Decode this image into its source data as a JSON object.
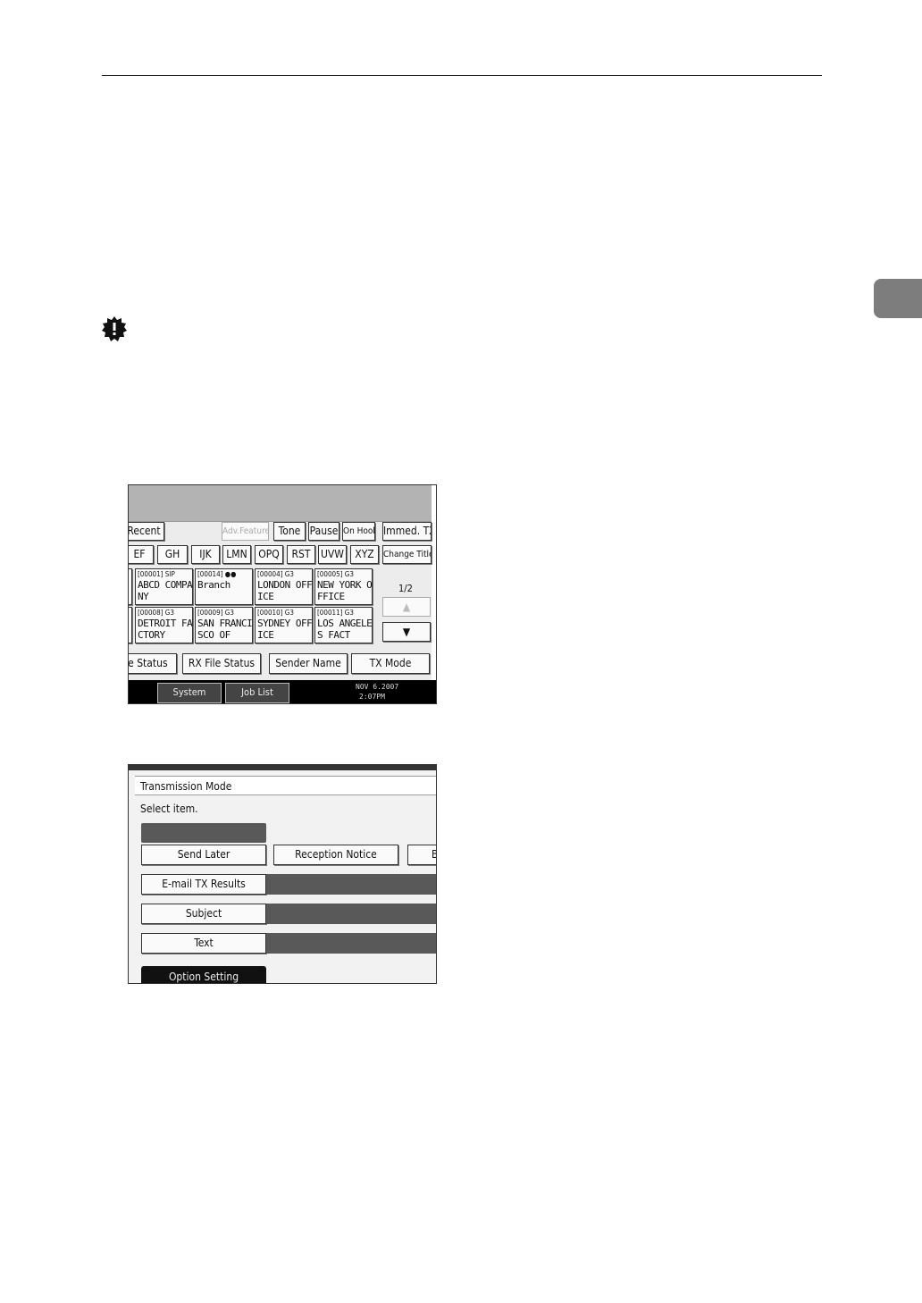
{
  "screen1": {
    "row1": [
      "Recent",
      "Adv.Features",
      "Tone",
      "Pause",
      "On Hook",
      "Immed. TX"
    ],
    "row2": [
      "EF",
      "GH",
      "IJK",
      "LMN",
      "OPQ",
      "RST",
      "UVW",
      "XYZ",
      "Change Title"
    ],
    "entries": [
      {
        "code": "[00001] SIP",
        "name1": "ABCD COMPA",
        "name2": "NY"
      },
      {
        "code": "[00014] ",
        "name1": "Branch",
        "name2": ""
      },
      {
        "code": "[00004] G3",
        "name1": "LONDON OFF",
        "name2": "ICE"
      },
      {
        "code": "[00005] G3",
        "name1": "NEW YORK O",
        "name2": "FFICE"
      },
      {
        "code": "[00008] G3",
        "name1": "DETROIT FA",
        "name2": "CTORY"
      },
      {
        "code": "[00009] G3",
        "name1": "SAN FRANCI",
        "name2": "SCO OF"
      },
      {
        "code": "[00010] G3",
        "name1": "SYDNEY OFF",
        "name2": "ICE"
      },
      {
        "code": "[00011] G3",
        "name1": "LOS ANGELE",
        "name2": "S FACT"
      }
    ],
    "page": "1/2",
    "up_arrow": "▲",
    "down_arrow": "▼",
    "bottom_row": [
      "TX File Status",
      "RX File Status",
      "Sender Name",
      "TX Mode"
    ],
    "status_buttons": [
      "System Status",
      "Job List"
    ],
    "date": "NOV   6.2007",
    "time": "2:07PM"
  },
  "screen2": {
    "title": "Transmission Mode",
    "instruction": "Select item.",
    "send_later": "Send Later",
    "reception_notice": "Reception Notice",
    "partial_btn": "B",
    "email_tx": "E-mail TX Results",
    "subject": "Subject",
    "text": "Text",
    "option_setting": "Option Setting"
  }
}
